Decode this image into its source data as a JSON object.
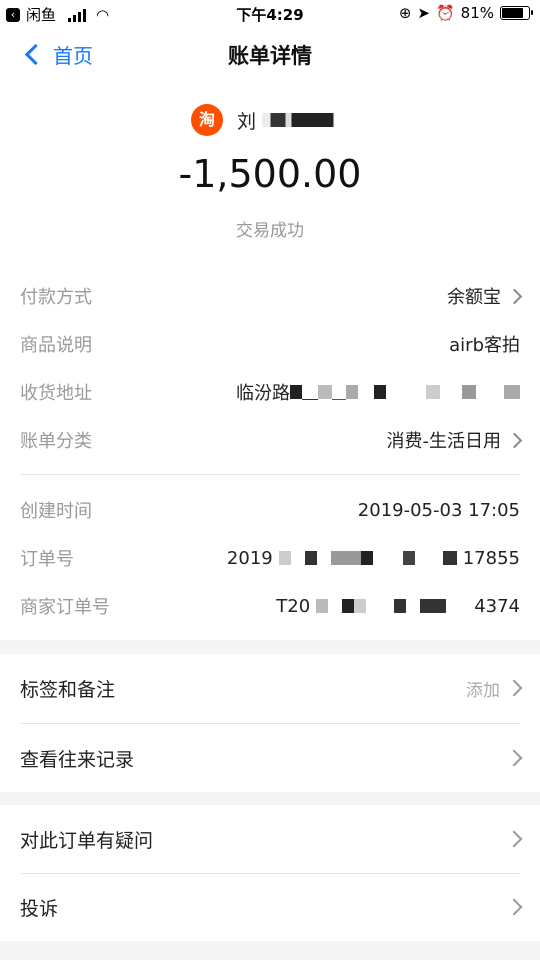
{
  "statusbar": {
    "back_app": "闲鱼",
    "time": "下午4:29",
    "battery": "81%",
    "battery_level": 0.81
  },
  "nav": {
    "back_label": "首页",
    "title": "账单详情"
  },
  "header": {
    "merchant_icon_text": "淘",
    "merchant_name": "刘",
    "amount": "-1,500.00",
    "status": "交易成功"
  },
  "details": [
    {
      "label": "付款方式",
      "value": "余额宝"
    },
    {
      "label": "商品说明",
      "value": "airb客拍"
    },
    {
      "label": "收货地址",
      "value": "临汾路"
    },
    {
      "label": "账单分类",
      "value": "消费-生活日用"
    },
    {
      "label": "创建时间",
      "value": "2019-05-03 17:05"
    },
    {
      "label": "订单号",
      "value_start": "2019",
      "value_end": "17855"
    },
    {
      "label": "商家订单号",
      "value_start": "T20",
      "value_end": "4374"
    }
  ],
  "actions_group1": [
    {
      "label": "标签和备注",
      "right": "添加"
    },
    {
      "label": "查看往来记录",
      "right": ""
    }
  ],
  "actions_group2": [
    {
      "label": "对此订单有疑问"
    },
    {
      "label": "投诉"
    }
  ],
  "icons": {
    "back": "chevron-left-icon",
    "merchant": "taobao-icon",
    "arrow": "chevron-right-icon",
    "wifi": "wifi-icon",
    "location": "location-arrow-icon",
    "alarm": "alarm-icon",
    "lock": "rotation-lock-icon"
  },
  "colors": {
    "accent": "#1677ff",
    "taobao": "#ff5000"
  }
}
